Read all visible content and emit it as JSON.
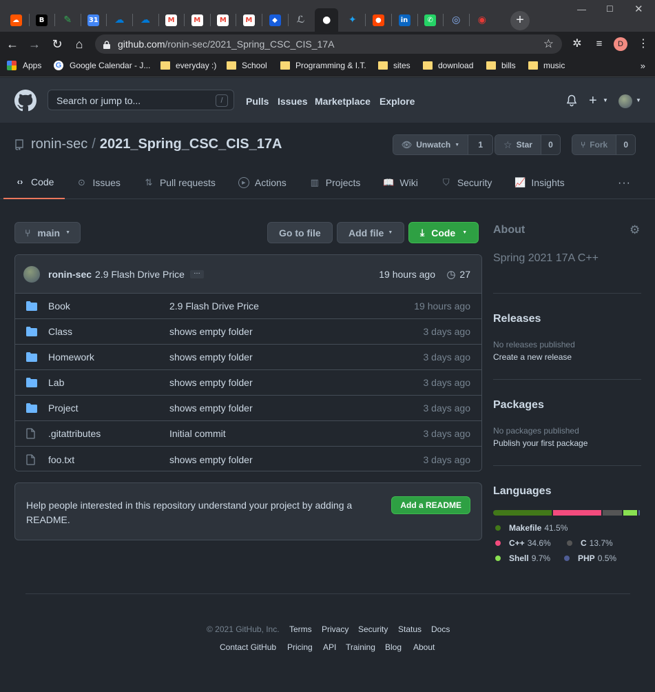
{
  "browser": {
    "url_domain": "github.com",
    "url_path": "/ronin-sec/2021_Spring_CSC_CIS_17A",
    "bookmarks": [
      {
        "label": "Apps",
        "type": "apps"
      },
      {
        "label": "Google Calendar - J...",
        "type": "google"
      },
      {
        "label": "everyday :)",
        "type": "folder"
      },
      {
        "label": "School",
        "type": "folder"
      },
      {
        "label": "Programming & I.T.",
        "type": "folder"
      },
      {
        "label": "sites",
        "type": "folder"
      },
      {
        "label": "download",
        "type": "folder"
      },
      {
        "label": "bills",
        "type": "folder"
      },
      {
        "label": "music",
        "type": "folder"
      }
    ],
    "profile_initial": "D",
    "tabs": [
      {
        "icon": "soundcloud-icon",
        "color": "#ff5500"
      },
      {
        "icon": "bandcamp-icon",
        "color": "#000000"
      },
      {
        "icon": "pen-icon",
        "color": "#34a853"
      },
      {
        "icon": "calendar-icon",
        "color": "#4285f4"
      },
      {
        "icon": "onedrive-icon",
        "color": "#0078d4"
      },
      {
        "icon": "onedrive-icon",
        "color": "#0078d4"
      },
      {
        "icon": "gmail-icon",
        "color": "#ea4335"
      },
      {
        "icon": "gmail-icon",
        "color": "#ea4335"
      },
      {
        "icon": "gmail-icon",
        "color": "#ea4335"
      },
      {
        "icon": "gmail-icon",
        "color": "#ea4335"
      },
      {
        "icon": "bitwarden-icon",
        "color": "#175ddc"
      },
      {
        "icon": "script-icon",
        "color": "#9aa0a6"
      },
      {
        "icon": "github-icon",
        "color": "#ffffff"
      },
      {
        "icon": "twitter-icon",
        "color": "#1da1f2"
      },
      {
        "icon": "reddit-icon",
        "color": "#ff4500"
      },
      {
        "icon": "linkedin-icon",
        "color": "#0a66c2"
      },
      {
        "icon": "whatsapp-icon",
        "color": "#25d366"
      },
      {
        "icon": "fingerprint-icon",
        "color": "#8ab4f8"
      },
      {
        "icon": "target-icon",
        "color": "#e53935"
      }
    ]
  },
  "gh_header": {
    "search_placeholder": "Search or jump to...",
    "slash": "/",
    "nav": [
      "Pulls",
      "Issues",
      "Marketplace",
      "Explore"
    ]
  },
  "repo": {
    "owner": "ronin-sec",
    "sep": "/",
    "name": "2021_Spring_CSC_CIS_17A",
    "watch_label": "Unwatch",
    "watch_count": "1",
    "star_label": "Star",
    "star_count": "0",
    "fork_label": "Fork",
    "fork_count": "0",
    "tabs": [
      "Code",
      "Issues",
      "Pull requests",
      "Actions",
      "Projects",
      "Wiki",
      "Security",
      "Insights"
    ],
    "more": "···"
  },
  "toolbar": {
    "branch": "main",
    "goto_file": "Go to file",
    "add_file": "Add file",
    "code": "Code"
  },
  "latest_commit": {
    "author": "ronin-sec",
    "message": "2.9 Flash Drive Price",
    "ellipsis": "…",
    "age": "19 hours ago",
    "count": "27"
  },
  "files": [
    {
      "name": "Book",
      "type": "folder",
      "message": "2.9 Flash Drive Price",
      "age": "19 hours ago"
    },
    {
      "name": "Class",
      "type": "folder",
      "message": "shows empty folder",
      "age": "3 days ago"
    },
    {
      "name": "Homework",
      "type": "folder",
      "message": "shows empty folder",
      "age": "3 days ago"
    },
    {
      "name": "Lab",
      "type": "folder",
      "message": "shows empty folder",
      "age": "3 days ago"
    },
    {
      "name": "Project",
      "type": "folder",
      "message": "shows empty folder",
      "age": "3 days ago"
    },
    {
      "name": ".gitattributes",
      "type": "file",
      "message": "Initial commit",
      "age": "3 days ago"
    },
    {
      "name": "foo.txt",
      "type": "file",
      "message": "shows empty folder",
      "age": "3 days ago"
    }
  ],
  "readme_prompt": {
    "text": "Help people interested in this repository understand your project by adding a README.",
    "button": "Add a README"
  },
  "sidebar": {
    "about_title": "About",
    "description": "Spring 2021 17A C++",
    "releases_title": "Releases",
    "releases_none": "No releases published",
    "releases_link": "Create a new release",
    "packages_title": "Packages",
    "packages_none": "No packages published",
    "packages_link": "Publish your first package",
    "languages_title": "Languages",
    "languages": [
      {
        "name": "Makefile",
        "pct": "41.5%",
        "value": 41.5,
        "color": "#427819"
      },
      {
        "name": "C++",
        "pct": "34.6%",
        "value": 34.6,
        "color": "#f34b7d"
      },
      {
        "name": "C",
        "pct": "13.7%",
        "value": 13.7,
        "color": "#555555"
      },
      {
        "name": "Shell",
        "pct": "9.7%",
        "value": 9.7,
        "color": "#89e051"
      },
      {
        "name": "PHP",
        "pct": "0.5%",
        "value": 0.5,
        "color": "#4f5d95"
      }
    ]
  },
  "footer": {
    "copyright": "© 2021 GitHub, Inc.",
    "row1": [
      "Terms",
      "Privacy",
      "Security",
      "Status",
      "Docs"
    ],
    "row2": [
      "Contact GitHub",
      "Pricing",
      "API",
      "Training",
      "Blog",
      "About"
    ]
  }
}
